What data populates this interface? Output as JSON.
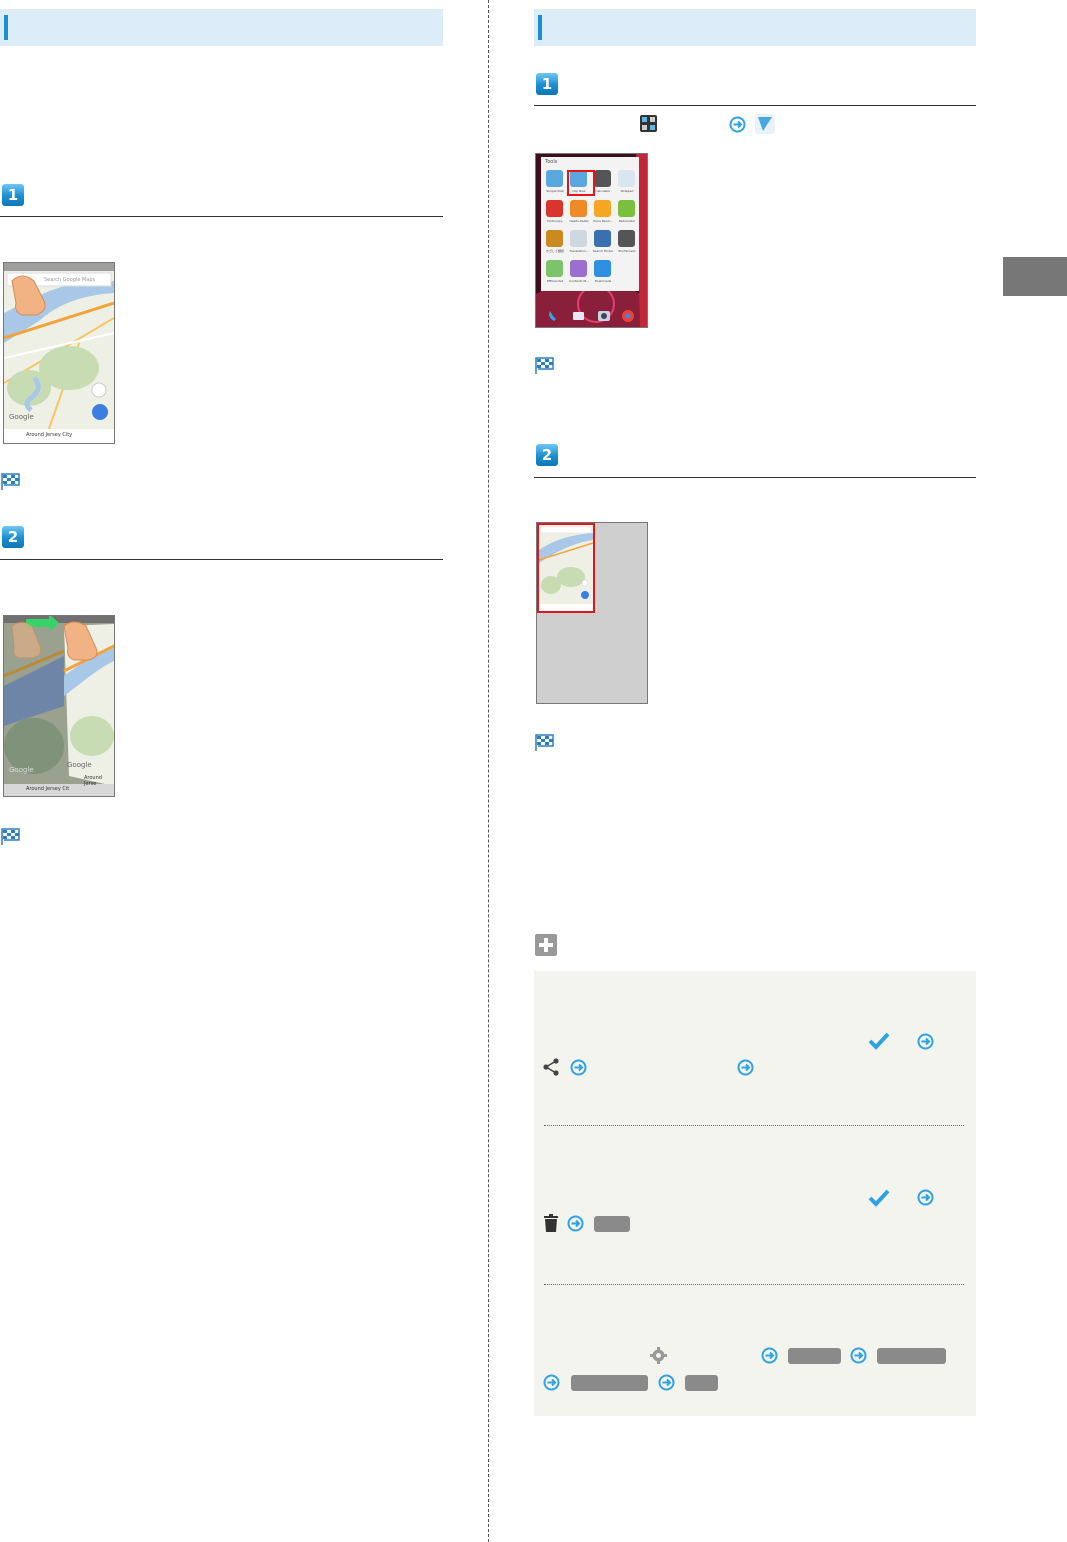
{
  "left": {
    "step1": {
      "number": "1"
    },
    "step2": {
      "number": "2"
    },
    "map_screenshot": {
      "search_placeholder": "Search Google Maps",
      "bottom_label": "Around Jersey City",
      "logo": "Google"
    },
    "map_screenshot2": {
      "bottom_label_left": "Around Jersey Cit",
      "bottom_label_right": "Around Jerse",
      "logo_left": "Google",
      "logo_right": "Google"
    }
  },
  "right": {
    "step1": {
      "number": "1"
    },
    "step2": {
      "number": "2"
    },
    "tools_screenshot": {
      "folder_title": "Tools",
      "apps": [
        "Simple Post",
        "Clip Now",
        "Calculator",
        "Notepad",
        "Dictionary",
        "Osaifu-Keitai",
        "Voice Recor...",
        "Pedometer",
        "かざして翻訳",
        "Translation...",
        "Search Finder",
        "PrintSmash",
        "Efficiendat",
        "Contents M...",
        "Downloads"
      ]
    }
  },
  "colors": {
    "accent": "#1a8fd6",
    "section_bg": "#dcedf8",
    "tip_bg": "#f4f4ef",
    "check": "#2fa3e0",
    "highlight": "#e0161c"
  },
  "icons": [
    "apps-grid-icon",
    "arrow-right-icon",
    "clip-now-icon",
    "checkmark-icon",
    "share-icon",
    "trash-icon",
    "settings-gear-icon",
    "plus-icon",
    "goal-flag-icon"
  ]
}
